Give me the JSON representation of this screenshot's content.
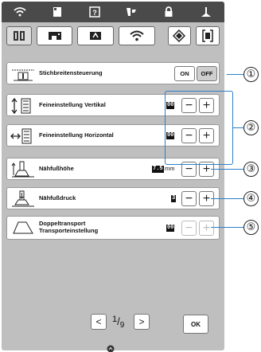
{
  "top_nav": {
    "icons": [
      "wifi-icon",
      "page-icon",
      "help-icon",
      "needle-threading-icon",
      "lock-icon",
      "presser-foot-icon"
    ]
  },
  "tabs": [
    {
      "name": "tab-sewing-settings",
      "icon": "book-icon"
    },
    {
      "name": "tab-machine-settings",
      "icon": "sewing-machine-icon"
    },
    {
      "name": "tab-embroidery-settings",
      "icon": "embroidery-frame-icon"
    },
    {
      "name": "tab-wlan-settings",
      "icon": "wifi-icon"
    },
    {
      "name": "tab-general-settings",
      "icon": "diamond-settings-icon"
    },
    {
      "name": "tab-screen-settings",
      "icon": "screen-bracket-icon"
    }
  ],
  "settings": {
    "stitch_width": {
      "label": "Stichbreitensteuerung",
      "on_label": "ON",
      "off_label": "OFF",
      "selected": "OFF"
    },
    "fine_vertical": {
      "label": "Feineinstellung Vertikal",
      "value": "00",
      "minus": "−",
      "plus": "+"
    },
    "fine_horizontal": {
      "label": "Feineinstellung Horizontal",
      "value": "00",
      "minus": "−",
      "plus": "+"
    },
    "presser_height": {
      "label": "Nähfußhöhe",
      "value": "7.5",
      "unit": "mm",
      "minus": "−",
      "plus": "+"
    },
    "presser_pressure": {
      "label": "Nähfußdruck",
      "value": "3",
      "minus": "−",
      "plus": "+"
    },
    "dual_feed": {
      "label_line1": "Doppeltransport",
      "label_line2": "Transporteinstellung",
      "value": "00",
      "minus": "−",
      "plus": "+",
      "disabled": true
    }
  },
  "pagination": {
    "prev": "<",
    "next": ">",
    "current": "1",
    "total": "9"
  },
  "ok_label": "OK",
  "callouts": [
    "①",
    "②",
    "③",
    "④",
    "⑤"
  ],
  "colors": {
    "callout_line": "#2c7fc9",
    "topbar": "#4a4a4a",
    "panel_bg": "#bfbfbf"
  }
}
